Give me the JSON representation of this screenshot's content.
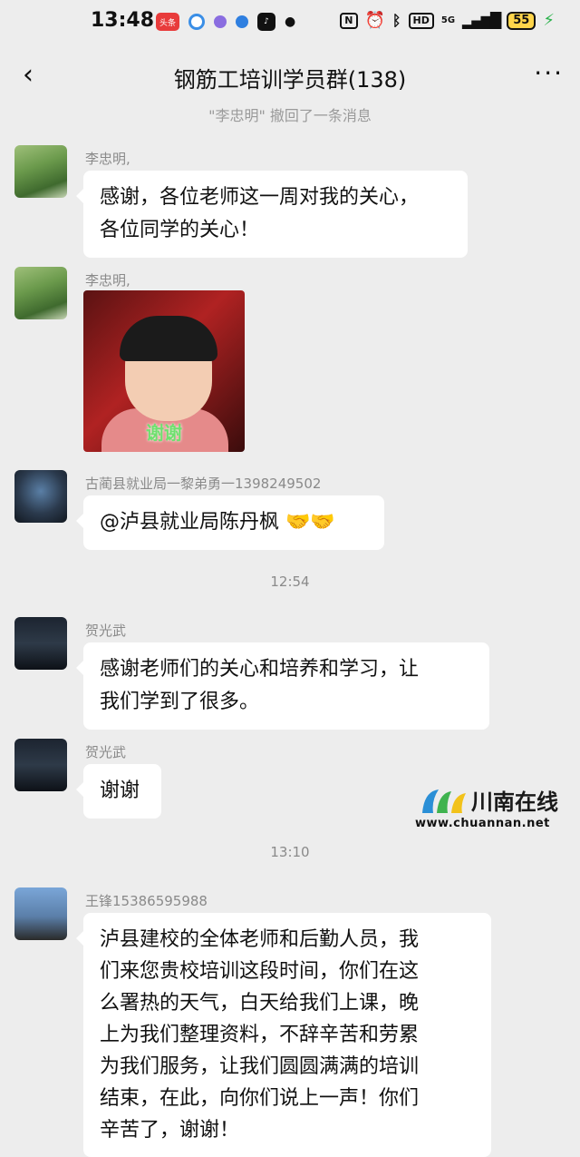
{
  "status_bar": {
    "time": "13:48",
    "app_badge": "头条",
    "battery": "55",
    "network": "5G",
    "hd": "HD",
    "nfc": "N"
  },
  "nav": {
    "title": "钢筋工培训学员群(138)",
    "back_icon": "chevron-left-icon",
    "more_icon": "ellipsis-icon"
  },
  "recall_notice": "\"李忠明\" 撤回了一条消息",
  "messages": [
    {
      "sender": "李忠明,",
      "text": "感谢，各位老师这一周对我的关心，\n各位同学的关心！"
    },
    {
      "sender": "李忠明,",
      "image_caption": "谢谢"
    },
    {
      "sender": "古蔺县就业局一黎弟勇一1398249502",
      "text": "@泸县就业局陈丹枫 🤝🤝"
    },
    {
      "timestamp": "12:54"
    },
    {
      "sender": "贺光武",
      "text": "感谢老师们的关心和培养和学习，让\n我们学到了很多。"
    },
    {
      "sender": "贺光武",
      "text": "谢谢"
    },
    {
      "timestamp": "13:10"
    },
    {
      "sender": "王锋15386595988",
      "text": "泸县建校的全体老师和后勤人员，我\n们来您贵校培训这段时间，你们在这\n么署热的天气，白天给我们上课，晚\n上为我们整理资料，不辞辛苦和劳累\n为我们服务，让我们圆圆满满的培训\n结束，在此，向你们说上一声！你们\n辛苦了，谢谢！"
    }
  ],
  "watermark": {
    "name": "川南在线",
    "url": "www.chuannan.net"
  }
}
